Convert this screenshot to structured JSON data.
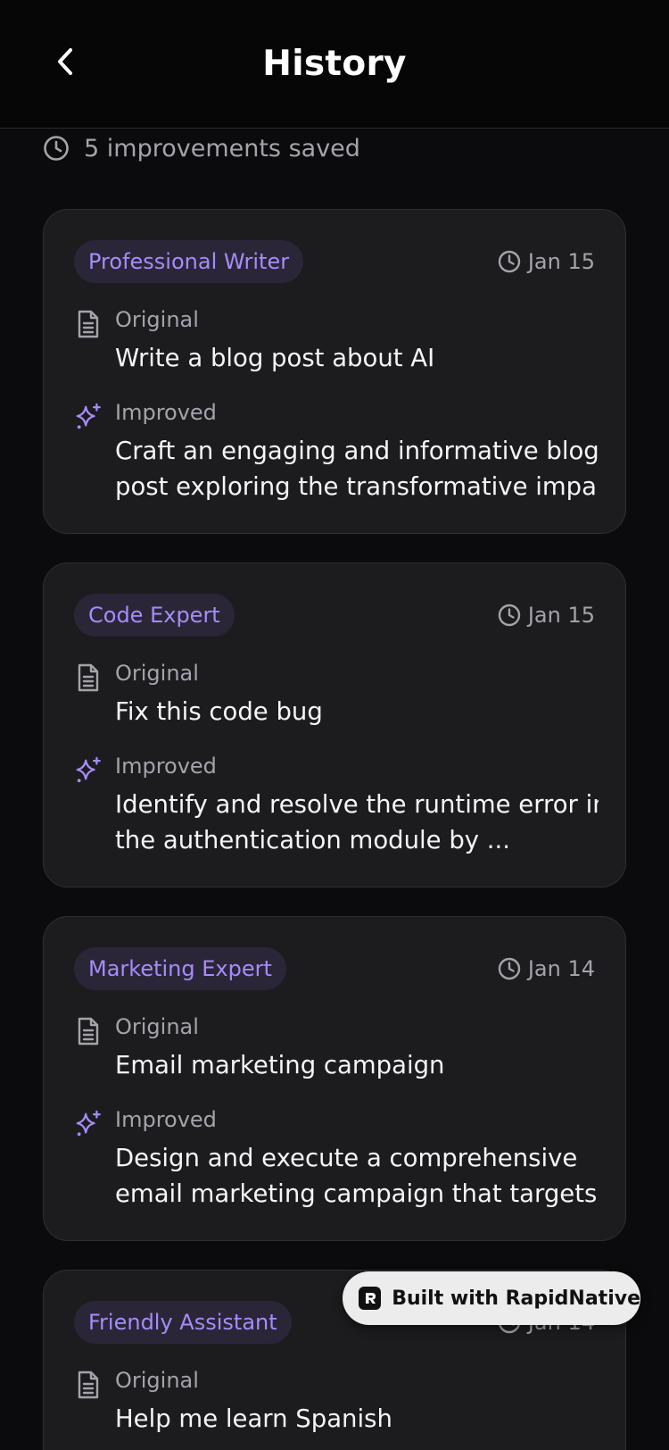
{
  "header": {
    "title": "History",
    "back_icon": "chevron-left-icon"
  },
  "summary": {
    "text": "5 improvements saved",
    "icon": "clock-icon"
  },
  "labels": {
    "original": "Original",
    "improved": "Improved"
  },
  "colors": {
    "accent": "#a78bfa",
    "badge_bg": "#2a2638",
    "card_bg": "#1c1c1f",
    "background": "#0b0b0d"
  },
  "items": [
    {
      "role": "Professional Writer",
      "date": "Jan 15",
      "original": "Write a blog post about AI",
      "improved_lines": [
        "Craft an engaging and informative blog",
        "post exploring the transformative impa..."
      ]
    },
    {
      "role": "Code Expert",
      "date": "Jan 15",
      "original": "Fix this code bug",
      "improved_lines": [
        "Identify and resolve the runtime error in",
        "the authentication module by ..."
      ]
    },
    {
      "role": "Marketing Expert",
      "date": "Jan 14",
      "original": "Email marketing campaign",
      "improved_lines": [
        "Design and execute a comprehensive",
        "email marketing campaign that targets ..."
      ]
    },
    {
      "role": "Friendly Assistant",
      "date": "Jan 14",
      "original": "Help me learn Spanish",
      "improved_lines": []
    }
  ],
  "built_with": {
    "label": "Built with RapidNative"
  }
}
